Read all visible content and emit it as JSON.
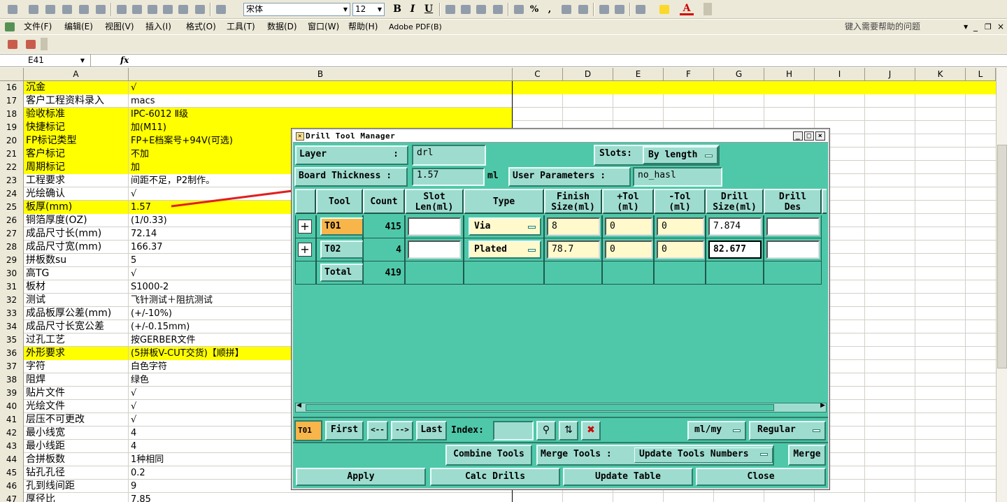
{
  "toolbar": {
    "font_name": "宋体",
    "font_size": "12",
    "bold": "B",
    "italic": "I",
    "underline": "U",
    "percent": "%",
    "comma": ",",
    "font_color_letter": "A"
  },
  "menu": {
    "items": [
      "文件(F)",
      "编辑(E)",
      "视图(V)",
      "插入(I)",
      "格式(O)",
      "工具(T)",
      "数据(D)",
      "窗口(W)",
      "帮助(H)",
      "Adobe PDF(B)"
    ],
    "help_placeholder": "键入需要帮助的问题"
  },
  "formula_bar": {
    "cell_ref": "E41",
    "fx": "fx"
  },
  "columns": [
    "A",
    "B",
    "C",
    "D",
    "E",
    "F",
    "G",
    "H",
    "I",
    "J",
    "K",
    "L"
  ],
  "rows": [
    {
      "n": "16",
      "a": "沉金",
      "b": "√",
      "hl": true
    },
    {
      "n": "17",
      "a": "客户工程资料录入",
      "b": "macs",
      "hl": false
    },
    {
      "n": "18",
      "a": "验收标准",
      "b": "IPC-6012 Ⅱ级",
      "hl": true
    },
    {
      "n": "19",
      "a": "快捷标记",
      "b": "加(M11)",
      "hl": true
    },
    {
      "n": "20",
      "a": "FP标记类型",
      "b": "FP+E档案号+94V(可选)",
      "hl": true
    },
    {
      "n": "21",
      "a": "客户标记",
      "b": "不加",
      "hl": true
    },
    {
      "n": "22",
      "a": "周期标记",
      "b": "加",
      "hl": true
    },
    {
      "n": "23",
      "a": "工程要求",
      "b": "间距不足，P2制作。",
      "hl": false
    },
    {
      "n": "24",
      "a": "光绘确认",
      "b": "√",
      "hl": false
    },
    {
      "n": "25",
      "a": "板厚(mm)",
      "b": "1.57",
      "hl": true
    },
    {
      "n": "26",
      "a": "铜箔厚度(OZ)",
      "b": " (1/0.33)",
      "hl": false
    },
    {
      "n": "27",
      "a": "成品尺寸长(mm)",
      "b": "72.14",
      "hl": false
    },
    {
      "n": "28",
      "a": "成品尺寸宽(mm)",
      "b": "166.37",
      "hl": false
    },
    {
      "n": "29",
      "a": "拼板数su",
      "b": "5",
      "hl": false
    },
    {
      "n": "30",
      "a": "高TG",
      "b": "√",
      "hl": false
    },
    {
      "n": "31",
      "a": "板材",
      "b": "S1000-2",
      "hl": false
    },
    {
      "n": "32",
      "a": "测试",
      "b": "飞针测试＋阻抗测试",
      "hl": false
    },
    {
      "n": "33",
      "a": "成品板厚公差(mm)",
      "b": "(+/-10%)",
      "hl": false
    },
    {
      "n": "34",
      "a": "成品尺寸长宽公差",
      "b": "(+/-0.15mm)",
      "hl": false
    },
    {
      "n": "35",
      "a": "过孔工艺",
      "b": "按GERBER文件",
      "hl": false
    },
    {
      "n": "36",
      "a": "外形要求",
      "b": "(5拼板V-CUT交货)【顺拼】",
      "hl": true
    },
    {
      "n": "37",
      "a": "字符",
      "b": "白色字符",
      "hl": false
    },
    {
      "n": "38",
      "a": "阻焊",
      "b": "绿色",
      "hl": false
    },
    {
      "n": "39",
      "a": "贴片文件",
      "b": "√",
      "hl": false
    },
    {
      "n": "40",
      "a": "光绘文件",
      "b": "√",
      "hl": false
    },
    {
      "n": "41",
      "a": "层压不可更改",
      "b": "√",
      "hl": false
    },
    {
      "n": "42",
      "a": "最小线宽",
      "b": "4",
      "hl": false
    },
    {
      "n": "43",
      "a": "最小线距",
      "b": "4",
      "hl": false
    },
    {
      "n": "44",
      "a": "合拼板数",
      "b": "1种相同",
      "hl": false
    },
    {
      "n": "45",
      "a": "钻孔孔径",
      "b": "0.2",
      "hl": false
    },
    {
      "n": "46",
      "a": "孔到线间距",
      "b": "9",
      "hl": false
    },
    {
      "n": "47",
      "a": "厚径比",
      "b": "7.85",
      "hl": false
    }
  ],
  "dialog": {
    "title": "Drill Tool Manager",
    "layer_label": "Layer",
    "layer_value": "drl",
    "slots_label": "Slots:",
    "slots_value": "By length",
    "board_thickness_label": "Board Thickness :",
    "board_thickness_value": "1.57",
    "board_thickness_unit": "ml",
    "user_params_label": "User Parameters :",
    "user_params_value": "no_hasl",
    "headers": [
      "Tool",
      "Count",
      "Slot\nLen(ml)",
      "Type",
      "Finish\nSize(ml)",
      "+Tol\n(ml)",
      "-Tol\n(ml)",
      "Drill\nSize(ml)",
      "Drill\nDes"
    ],
    "tools": [
      {
        "tool": "T01",
        "count": "415",
        "slot": "",
        "type": "Via",
        "finish": "8",
        "ptol": "0",
        "mtol": "0",
        "drill": "7.874",
        "des": ""
      },
      {
        "tool": "T02",
        "count": "4",
        "slot": "",
        "type": "Plated",
        "finish": "78.7",
        "ptol": "0",
        "mtol": "0",
        "drill": "82.677",
        "des": ""
      }
    ],
    "total_label": "Total",
    "total_count": "419",
    "nav": {
      "current": "T01",
      "first": "First",
      "prev": "<--",
      "next": "-->",
      "last": "Last",
      "index_label": "Index:",
      "units": "ml/my",
      "mode": "Regular"
    },
    "combine_tools": "Combine Tools",
    "merge_tools_label": "Merge Tools :",
    "update_tools_numbers": "Update Tools Numbers",
    "merge": "Merge",
    "apply": "Apply",
    "calc_drills": "Calc Drills",
    "update_table": "Update Table",
    "close": "Close"
  },
  "colors": {
    "highlight": "#ffff00",
    "dialog_bg": "#4fc8aa",
    "arrow": "#e02020"
  }
}
